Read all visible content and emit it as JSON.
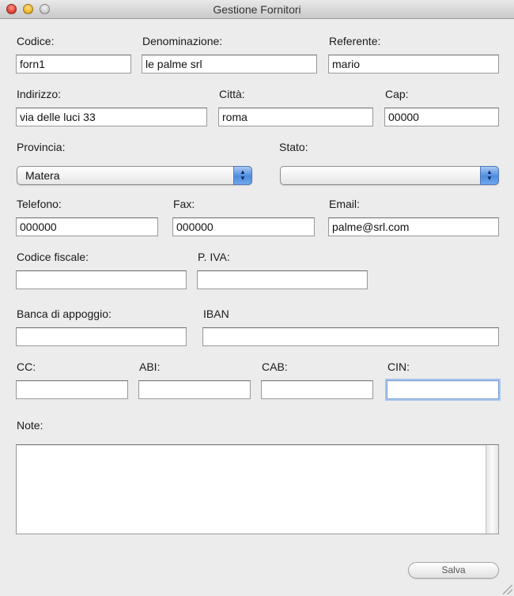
{
  "window": {
    "title": "Gestione Fornitori"
  },
  "form": {
    "codice": {
      "label": "Codice:",
      "value": "forn1"
    },
    "denominazione": {
      "label": "Denominazione:",
      "value": "le palme srl"
    },
    "referente": {
      "label": "Referente:",
      "value": "mario"
    },
    "indirizzo": {
      "label": "Indirizzo:",
      "value": "via delle luci 33"
    },
    "citta": {
      "label": "Città:",
      "value": "roma"
    },
    "cap": {
      "label": "Cap:",
      "value": "00000"
    },
    "provincia": {
      "label": "Provincia:",
      "selected": "Matera"
    },
    "stato": {
      "label": "Stato:",
      "selected": ""
    },
    "telefono": {
      "label": "Telefono:",
      "value": "000000"
    },
    "fax": {
      "label": "Fax:",
      "value": "000000"
    },
    "email": {
      "label": "Email:",
      "value": "palme@srl.com"
    },
    "codice_fiscale": {
      "label": "Codice fiscale:",
      "value": ""
    },
    "piva": {
      "label": "P. IVA:",
      "value": ""
    },
    "banca": {
      "label": "Banca di appoggio:",
      "value": ""
    },
    "iban": {
      "label": "IBAN",
      "value": ""
    },
    "cc": {
      "label": "CC:",
      "value": ""
    },
    "abi": {
      "label": "ABI:",
      "value": ""
    },
    "cab": {
      "label": "CAB:",
      "value": ""
    },
    "cin": {
      "label": "CIN:",
      "value": ""
    },
    "note": {
      "label": "Note:",
      "value": ""
    }
  },
  "actions": {
    "save_label": "Salva"
  },
  "icons": {
    "close": "close-icon",
    "minimize": "minimize-icon",
    "zoom": "zoom-icon",
    "select_arrows": "up-down-arrows-icon",
    "resize": "resize-grip-icon"
  }
}
